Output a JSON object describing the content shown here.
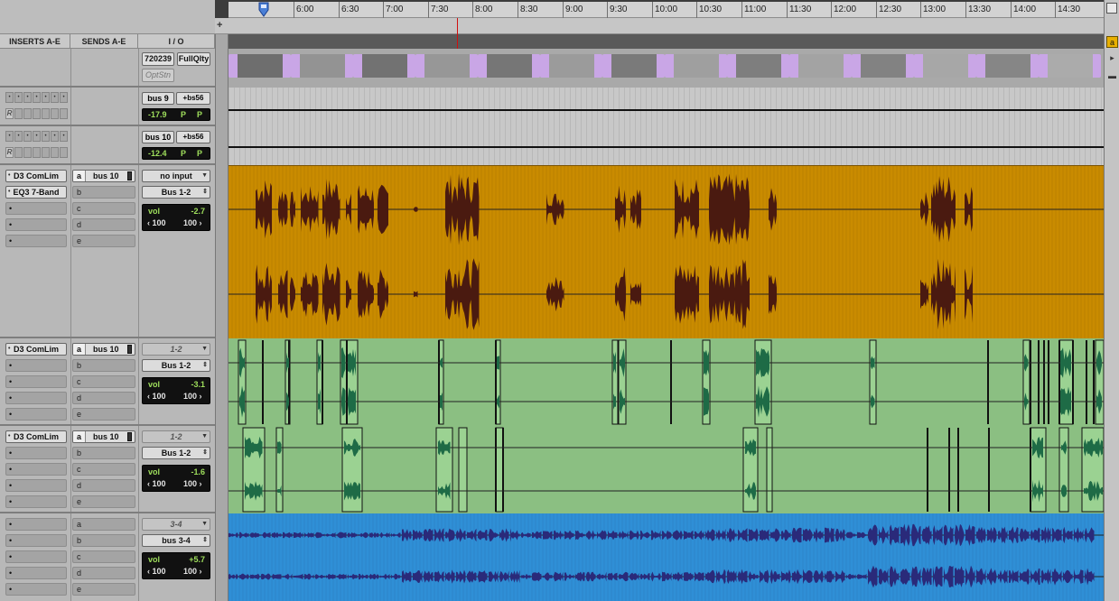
{
  "ruler": {
    "times": [
      "6:00",
      "6:30",
      "7:00",
      "7:30",
      "8:00",
      "8:30",
      "9:00",
      "9:30",
      "10:00",
      "10:30",
      "11:00",
      "11:30",
      "12:00",
      "12:30",
      "13:00",
      "13:30",
      "14:00",
      "14:30"
    ]
  },
  "columns": {
    "inserts": "INSERTS A-E",
    "sends": "SENDS A-E",
    "io": "I / O"
  },
  "video_track": {
    "field1": "720239",
    "field2": "FullQlty",
    "field3": "OptStn"
  },
  "aux_tracks": [
    {
      "out": "bus 9",
      "out2": "+bs56",
      "vol": "-17.9",
      "pan_l": "P",
      "pan_r": "P",
      "r_label": "R"
    },
    {
      "out": "bus 10",
      "out2": "+bs56",
      "vol": "-12.4",
      "pan_l": "P",
      "pan_r": "P",
      "r_label": "R"
    }
  ],
  "audio_tracks": [
    {
      "insert_a": "D3 ComLim",
      "insert_b": "EQ3 7-Band",
      "send_letter_a": "a",
      "send_a": "bus 10",
      "letters": [
        "b",
        "c",
        "d",
        "e"
      ],
      "input": "no input",
      "output": "Bus 1-2",
      "vol_label": "vol",
      "vol": "-2.7",
      "pan_l": "‹ 100",
      "pan_r": "100 ›"
    },
    {
      "insert_a": "D3 ComLim",
      "send_letter_a": "a",
      "send_a": "bus 10",
      "letters": [
        "b",
        "c",
        "d",
        "e"
      ],
      "input": "1-2",
      "output": "Bus 1-2",
      "vol_label": "vol",
      "vol": "-3.1",
      "pan_l": "‹ 100",
      "pan_r": "100 ›"
    },
    {
      "insert_a": "D3 ComLim",
      "send_letter_a": "a",
      "send_a": "bus 10",
      "letters": [
        "b",
        "c",
        "d",
        "e"
      ],
      "input": "1-2",
      "output": "Bus 1-2",
      "vol_label": "vol",
      "vol": "-1.6",
      "pan_l": "‹ 100",
      "pan_r": "100 ›"
    },
    {
      "letters": [
        "a",
        "b",
        "c",
        "d",
        "e"
      ],
      "input": "3-4",
      "output": "bus 3-4",
      "vol_label": "vol",
      "vol": "+5.7",
      "pan_l": "‹ 100",
      "pan_r": "100 ›"
    }
  ],
  "plus_label": "+",
  "colors": {
    "orange": "#c98b00",
    "green": "#8bbf82",
    "blue": "#2f8fd6",
    "waveform_dark": "#4a1a10",
    "waveform_blue": "#2a2a7a",
    "meter_text": "#9fdf5c"
  }
}
